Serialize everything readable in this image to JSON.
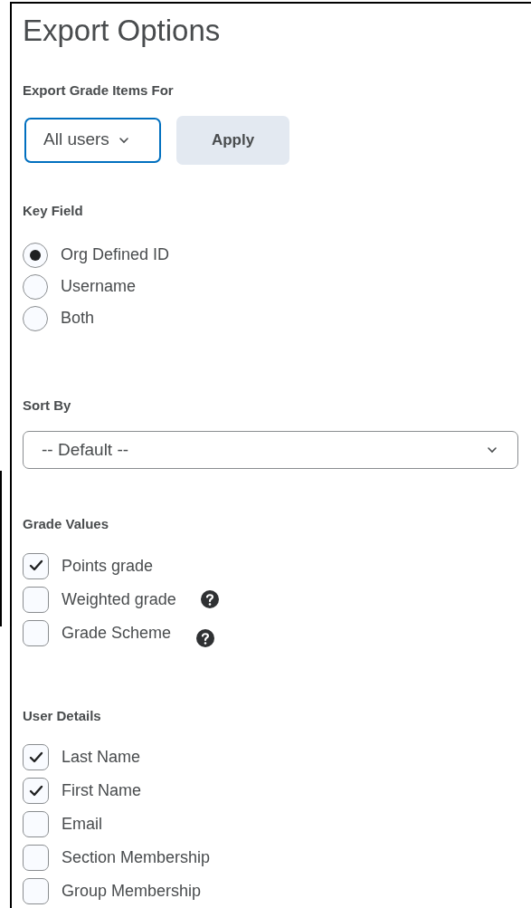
{
  "title": "Export Options",
  "export_for": {
    "label": "Export Grade Items For",
    "dropdown": "All users",
    "button": "Apply"
  },
  "key_field": {
    "label": "Key Field",
    "options": [
      {
        "label": "Org Defined ID",
        "selected": true
      },
      {
        "label": "Username",
        "selected": false
      },
      {
        "label": "Both",
        "selected": false
      }
    ]
  },
  "sort_by": {
    "label": "Sort By",
    "dropdown": "-- Default --"
  },
  "grade_values": {
    "label": "Grade Values",
    "options": [
      {
        "label": "Points grade",
        "checked": true,
        "help": false
      },
      {
        "label": "Weighted grade",
        "checked": false,
        "help": true
      },
      {
        "label": "Grade Scheme",
        "checked": false,
        "help": true
      }
    ]
  },
  "user_details": {
    "label": "User Details",
    "options": [
      {
        "label": "Last Name",
        "checked": true
      },
      {
        "label": "First Name",
        "checked": true
      },
      {
        "label": "Email",
        "checked": false
      },
      {
        "label": "Section Membership",
        "checked": false
      },
      {
        "label": "Group Membership",
        "checked": false
      }
    ]
  }
}
